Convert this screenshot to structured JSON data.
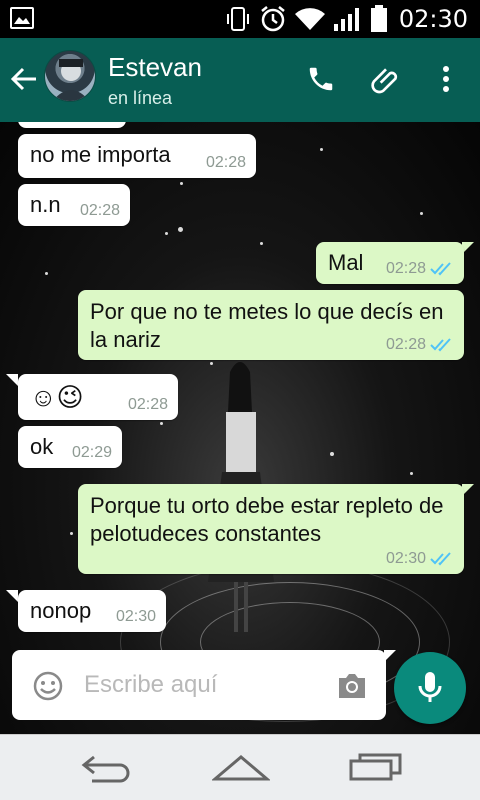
{
  "status_bar": {
    "time": "02:30"
  },
  "header": {
    "contact_name": "Estevan",
    "contact_status": "en línea"
  },
  "messages": [
    {
      "direction": "in",
      "text": "no me importa",
      "time": "02:28"
    },
    {
      "direction": "in",
      "text": "n.n",
      "time": "02:28"
    },
    {
      "direction": "out",
      "text": "Mal",
      "time": "02:28",
      "read": true
    },
    {
      "direction": "out",
      "text": "Por que no te metes lo que decís en la nariz",
      "time": "02:28",
      "read": true
    },
    {
      "direction": "in",
      "text": "☺😉",
      "time": "02:28"
    },
    {
      "direction": "in",
      "text": "ok",
      "time": "02:29"
    },
    {
      "direction": "out",
      "text": "Porque tu orto debe estar repleto de pelotudeces constantes",
      "time": "02:30",
      "read": true
    },
    {
      "direction": "in",
      "text": "nonop",
      "time": "02:30"
    }
  ],
  "composer": {
    "placeholder": "Escribe aquí"
  },
  "colors": {
    "header": "#075e54",
    "outgoing_bubble": "#dcf8c6",
    "incoming_bubble": "#ffffff",
    "mic_button": "#0a8a7c",
    "read_ticks": "#4fc3f7"
  },
  "icons": {
    "status_left": "image-icon",
    "status_right": [
      "vibrate-icon",
      "alarm-icon",
      "wifi-icon",
      "signal-icon",
      "battery-icon"
    ],
    "header_actions": [
      "phone-icon",
      "attachment-icon",
      "more-vert-icon"
    ],
    "composer": [
      "emoji-icon",
      "camera-icon",
      "mic-icon"
    ],
    "nav": [
      "back-icon",
      "home-icon",
      "recents-icon"
    ]
  }
}
